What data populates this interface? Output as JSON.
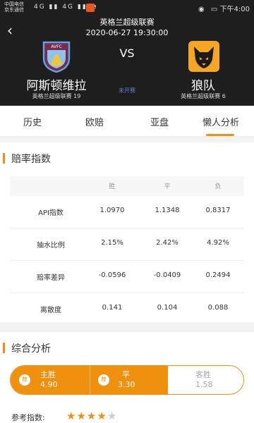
{
  "status_bar": {
    "carrier_1": "中国电信",
    "carrier_2": "京东通信",
    "signal": "4G ▮▮ 4G ▮▮ ◔",
    "time": "下午4:00"
  },
  "match": {
    "league": "英格兰超级联赛",
    "datetime": "2020-06-27 19:30:00",
    "vs": "VS",
    "status": "未开赛",
    "home": {
      "name": "阿斯顿维拉",
      "rank": "英格兰超级联赛 19",
      "logo_text": "AVFC"
    },
    "away": {
      "name": "狼队",
      "rank": "英格兰超级联赛 6"
    }
  },
  "tabs": [
    "历史",
    "欧赔",
    "亚盘",
    "懒人分析"
  ],
  "active_tab": 3,
  "odds_index": {
    "title": "赔率指数",
    "columns": [
      "胜",
      "平",
      "负"
    ],
    "rows": [
      {
        "label": "API指数",
        "values": [
          "1.0970",
          "1.1348",
          "0.8317"
        ]
      },
      {
        "label": "抽水比例",
        "values": [
          "2.15%",
          "2.42%",
          "4.92%"
        ]
      },
      {
        "label": "赔率差异",
        "values": [
          "-0.0596",
          "-0.0409",
          "0.2494"
        ]
      },
      {
        "label": "离散度",
        "values": [
          "0.141",
          "0.104",
          "0.088"
        ]
      }
    ]
  },
  "analysis": {
    "title": "综合分析",
    "badge": "荐",
    "options": [
      {
        "label": "主胜",
        "value": "4.90",
        "recommended": true
      },
      {
        "label": "平",
        "value": "3.30",
        "recommended": true
      },
      {
        "label": "客胜",
        "value": "1.58",
        "recommended": false
      }
    ],
    "reference_label": "参考指数:",
    "rating": 4,
    "rating_max": 5
  },
  "colors": {
    "accent": "#f0900f",
    "header_bg": "#1e1e1e",
    "status_blue": "#5b82c8"
  }
}
